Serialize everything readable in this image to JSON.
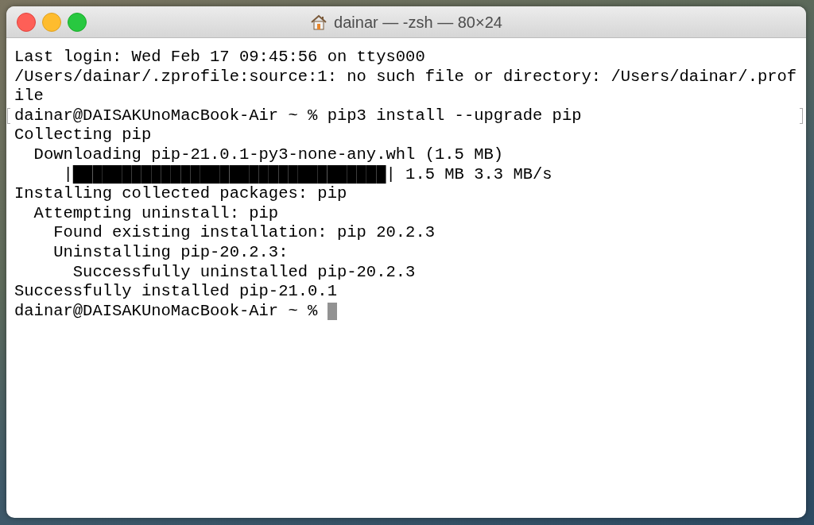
{
  "window": {
    "title": "dainar — -zsh — 80×24"
  },
  "terminal": {
    "lines": [
      {
        "text": "Last login: Wed Feb 17 09:45:56 on ttys000",
        "marked": false
      },
      {
        "text": "/Users/dainar/.zprofile:source:1: no such file or directory: /Users/dainar/.prof",
        "marked": false
      },
      {
        "text": "ile",
        "marked": false
      },
      {
        "text": "dainar@DAISAKUnoMacBook-Air ~ % pip3 install --upgrade pip",
        "marked": true
      },
      {
        "text": "Collecting pip",
        "marked": false
      },
      {
        "text": "  Downloading pip-21.0.1-py3-none-any.whl (1.5 MB)",
        "marked": false
      },
      {
        "text": "     |████████████████████████████████| 1.5 MB 3.3 MB/s",
        "marked": false
      },
      {
        "text": "Installing collected packages: pip",
        "marked": false
      },
      {
        "text": "  Attempting uninstall: pip",
        "marked": false
      },
      {
        "text": "    Found existing installation: pip 20.2.3",
        "marked": false
      },
      {
        "text": "    Uninstalling pip-20.2.3:",
        "marked": false
      },
      {
        "text": "      Successfully uninstalled pip-20.2.3",
        "marked": false
      },
      {
        "text": "Successfully installed pip-21.0.1",
        "marked": false
      },
      {
        "text": "dainar@DAISAKUnoMacBook-Air ~ % ",
        "marked": false
      }
    ]
  }
}
